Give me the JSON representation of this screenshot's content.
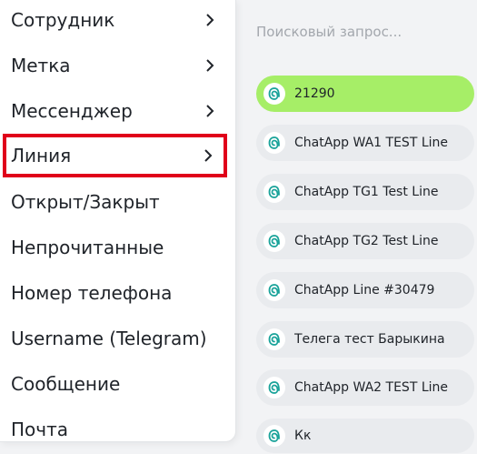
{
  "menu": {
    "items": [
      {
        "label": "Сотрудник",
        "submenu": true
      },
      {
        "label": "Метка",
        "submenu": true
      },
      {
        "label": "Мессенджер",
        "submenu": true
      },
      {
        "label": "Линия",
        "submenu": true,
        "highlighted": true
      },
      {
        "label": "Открыт/Закрыт",
        "submenu": false
      },
      {
        "label": "Непрочитанные",
        "submenu": false
      },
      {
        "label": "Номер телефона",
        "submenu": false
      },
      {
        "label": "Username (Telegram)",
        "submenu": false
      },
      {
        "label": "Сообщение",
        "submenu": false
      },
      {
        "label": "Почта",
        "submenu": false
      }
    ]
  },
  "panel": {
    "search": {
      "placeholder": "Поисковый запрос..."
    },
    "lines": [
      {
        "label": "21290",
        "active": true
      },
      {
        "label": "ChatApp WA1 TEST Line",
        "active": false
      },
      {
        "label": "ChatApp TG1 Test Line",
        "active": false
      },
      {
        "label": "ChatApp TG2 Test Line",
        "active": false
      },
      {
        "label": "ChatApp Line #30479",
        "active": false
      },
      {
        "label": "Телега тест Барыкина",
        "active": false
      },
      {
        "label": "ChatApp WA2 TEST Line",
        "active": false
      },
      {
        "label": "Кк",
        "active": false
      }
    ]
  },
  "colors": {
    "active_line": "#a6ee67",
    "highlight_border": "#e0001a",
    "logo_teal": "#1aa39a"
  },
  "icons": {
    "chevron": "chevron-right-icon",
    "line_logo": "chatapp-logo-icon"
  }
}
